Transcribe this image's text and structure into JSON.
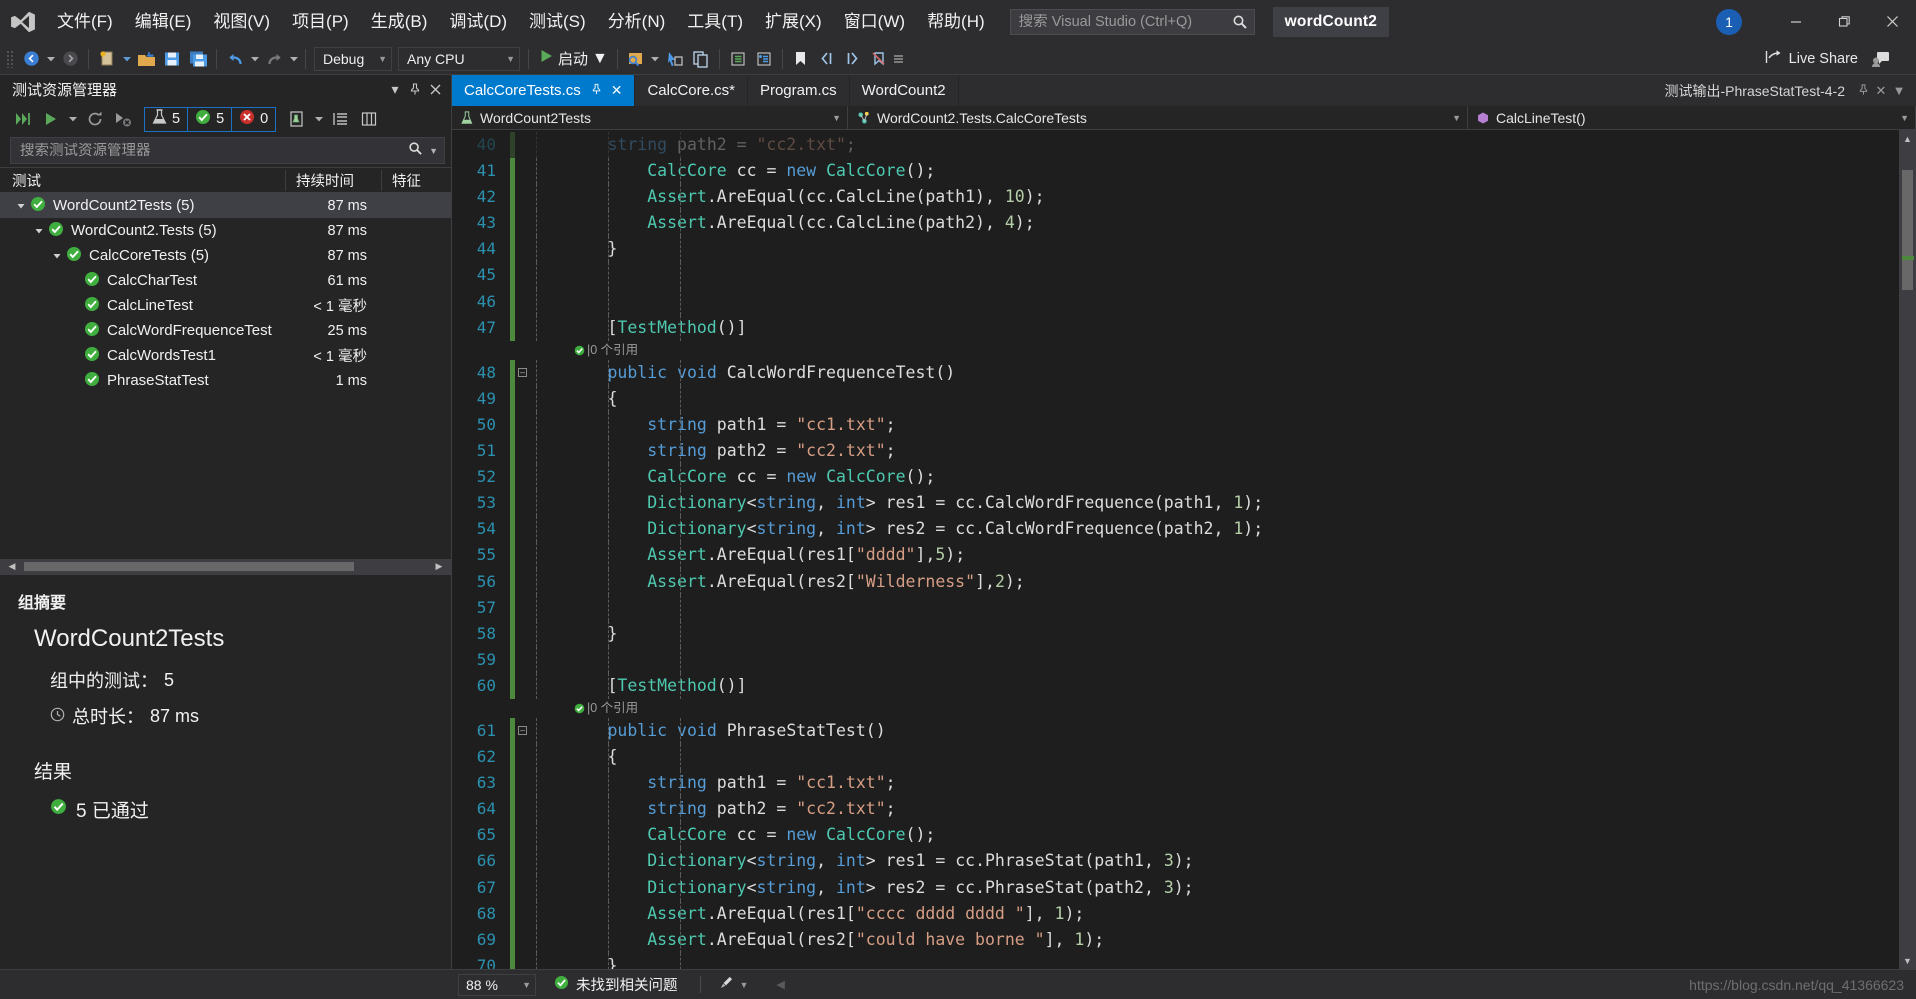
{
  "title_bar": {
    "logo_icon": "visual-studio-logo",
    "menus": [
      "文件(F)",
      "编辑(E)",
      "视图(V)",
      "项目(P)",
      "生成(B)",
      "调试(D)",
      "测试(S)",
      "分析(N)",
      "工具(T)",
      "扩展(X)",
      "窗口(W)",
      "帮助(H)"
    ],
    "search_placeholder": "搜索 Visual Studio (Ctrl+Q)",
    "search_value": "",
    "project_title": "wordCount2",
    "notification_count": "1",
    "minimize_label": "—",
    "restore_label": "❐",
    "close_label": "✕"
  },
  "toolbar": {
    "back_icon": "navigate-back-icon",
    "forward_icon": "navigate-forward-icon",
    "new_item_icon": "new-item-icon",
    "open_icon": "open-file-icon",
    "save_icon": "save-icon",
    "save_all_icon": "save-all-icon",
    "undo_icon": "undo-icon",
    "redo_icon": "redo-icon",
    "config_value": "Debug",
    "platform_value": "Any CPU",
    "start_label": "启动",
    "start_icon": "play-icon",
    "live_share_label": "Live Share",
    "live_share_icon": "live-share-icon",
    "feedback_icon": "feedback-icon"
  },
  "test_explorer": {
    "panel_title": "测试资源管理器",
    "pin_icon": "pin-icon",
    "close_icon": "close-icon",
    "run_all_icon": "run-all-tests-icon",
    "run_icon": "run-tests-icon",
    "repeat_icon": "repeat-last-run-icon",
    "cancel_icon": "cancel-run-icon",
    "counters": [
      {
        "icon": "flask-icon",
        "value": "5",
        "color": "#c9c9c9"
      },
      {
        "icon": "passed-icon",
        "value": "5",
        "color": "#4ec94e"
      },
      {
        "icon": "failed-icon",
        "value": "0",
        "color": "#e05c5c"
      }
    ],
    "playlist_icon": "playlist-icon",
    "group_icon": "group-by-icon",
    "columns_icon": "columns-icon",
    "search_placeholder": "搜索测试资源管理器",
    "search_value": "",
    "columns": [
      "测试",
      "持续时间",
      "特征"
    ],
    "rows": [
      {
        "label": "WordCount2Tests (5)",
        "duration": "87 ms",
        "depth": 0,
        "expander": "expanded",
        "status": "passed",
        "selected": true
      },
      {
        "label": "WordCount2.Tests (5)",
        "duration": "87 ms",
        "depth": 1,
        "expander": "expanded",
        "status": "passed",
        "selected": false
      },
      {
        "label": "CalcCoreTests (5)",
        "duration": "87 ms",
        "depth": 2,
        "expander": "expanded",
        "status": "passed",
        "selected": false
      },
      {
        "label": "CalcCharTest",
        "duration": "61 ms",
        "depth": 3,
        "expander": "none",
        "status": "passed",
        "selected": false
      },
      {
        "label": "CalcLineTest",
        "duration": "< 1 毫秒",
        "depth": 3,
        "expander": "none",
        "status": "passed",
        "selected": false
      },
      {
        "label": "CalcWordFrequenceTest",
        "duration": "25 ms",
        "depth": 3,
        "expander": "none",
        "status": "passed",
        "selected": false
      },
      {
        "label": "CalcWordsTest1",
        "duration": "< 1 毫秒",
        "depth": 3,
        "expander": "none",
        "status": "passed",
        "selected": false
      },
      {
        "label": "PhraseStatTest",
        "duration": "1 ms",
        "depth": 3,
        "expander": "none",
        "status": "passed",
        "selected": false
      }
    ],
    "summary": {
      "header": "组摘要",
      "name": "WordCount2Tests",
      "tests_in_group_label": "组中的测试：",
      "tests_in_group_value": "5",
      "total_duration_label": "总时长：",
      "total_duration_value": "87 ms",
      "clock_icon": "clock-icon",
      "results_header": "结果",
      "results_icon": "passed-icon",
      "results_text": "5  已通过"
    }
  },
  "editor": {
    "tabs": [
      {
        "label": "CalcCoreTests.cs",
        "active": true,
        "pin_icon": "pin-icon",
        "close_icon": "close-icon"
      },
      {
        "label": "CalcCore.cs*",
        "active": false
      },
      {
        "label": "Program.cs",
        "active": false
      },
      {
        "label": "WordCount2",
        "active": false
      }
    ],
    "output_tab": {
      "label": "测试输出-PhraseStatTest-4-2",
      "pin_icon": "pin-icon",
      "close_icon": "close-icon",
      "dropdown_icon": "chevron-down-icon"
    },
    "breadcrumb": [
      {
        "label": "WordCount2Tests",
        "icon": "project-icon"
      },
      {
        "label": "WordCount2.Tests.CalcCoreTests",
        "icon": "class-icon"
      },
      {
        "label": "CalcLineTest()",
        "icon": "method-icon"
      }
    ],
    "code_lines": [
      {
        "num": "40",
        "partial": true,
        "tokens": [
          {
            "t": "        ",
            "c": "pun"
          },
          {
            "t": "string",
            "c": "kw"
          },
          {
            "t": " path2 = ",
            "c": "id"
          },
          {
            "t": "\"cc2.txt\"",
            "c": "str"
          },
          {
            "t": ";",
            "c": "pun"
          }
        ],
        "change": "mod"
      },
      {
        "num": "41",
        "tokens": [
          {
            "t": "            ",
            "c": "pun"
          },
          {
            "t": "CalcCore",
            "c": "typ"
          },
          {
            "t": " cc = ",
            "c": "id"
          },
          {
            "t": "new",
            "c": "kw"
          },
          {
            "t": " ",
            "c": "id"
          },
          {
            "t": "CalcCore",
            "c": "typ"
          },
          {
            "t": "();",
            "c": "pun"
          }
        ],
        "change": "mod"
      },
      {
        "num": "42",
        "tokens": [
          {
            "t": "            ",
            "c": "pun"
          },
          {
            "t": "Assert",
            "c": "typ"
          },
          {
            "t": ".AreEqual(cc.CalcLine(path1), ",
            "c": "id"
          },
          {
            "t": "10",
            "c": "num2"
          },
          {
            "t": ");",
            "c": "pun"
          }
        ],
        "change": "mod"
      },
      {
        "num": "43",
        "tokens": [
          {
            "t": "            ",
            "c": "pun"
          },
          {
            "t": "Assert",
            "c": "typ"
          },
          {
            "t": ".AreEqual(cc.CalcLine(path2), ",
            "c": "id"
          },
          {
            "t": "4",
            "c": "num2"
          },
          {
            "t": ");",
            "c": "pun"
          }
        ],
        "change": "mod"
      },
      {
        "num": "44",
        "tokens": [
          {
            "t": "        }",
            "c": "pun"
          }
        ],
        "change": "mod"
      },
      {
        "num": "45",
        "tokens": [],
        "change": "mod"
      },
      {
        "num": "46",
        "tokens": [],
        "change": "mod"
      },
      {
        "num": "47",
        "tokens": [
          {
            "t": "        [",
            "c": "pun"
          },
          {
            "t": "TestMethod",
            "c": "typ"
          },
          {
            "t": "()]",
            "c": "pun"
          }
        ],
        "change": "mod",
        "ref": "0 个引用"
      },
      {
        "num": "48",
        "tokens": [
          {
            "t": "        ",
            "c": "pun"
          },
          {
            "t": "public",
            "c": "kw"
          },
          {
            "t": " ",
            "c": "id"
          },
          {
            "t": "void",
            "c": "kw"
          },
          {
            "t": " CalcWordFrequenceTest()",
            "c": "id"
          }
        ],
        "change": "mod",
        "fold": true
      },
      {
        "num": "49",
        "tokens": [
          {
            "t": "        {",
            "c": "pun"
          }
        ],
        "change": "mod"
      },
      {
        "num": "50",
        "tokens": [
          {
            "t": "            ",
            "c": "pun"
          },
          {
            "t": "string",
            "c": "kw"
          },
          {
            "t": " path1 = ",
            "c": "id"
          },
          {
            "t": "\"cc1.txt\"",
            "c": "str"
          },
          {
            "t": ";",
            "c": "pun"
          }
        ],
        "change": "mod"
      },
      {
        "num": "51",
        "tokens": [
          {
            "t": "            ",
            "c": "pun"
          },
          {
            "t": "string",
            "c": "kw"
          },
          {
            "t": " path2 = ",
            "c": "id"
          },
          {
            "t": "\"cc2.txt\"",
            "c": "str"
          },
          {
            "t": ";",
            "c": "pun"
          }
        ],
        "change": "mod"
      },
      {
        "num": "52",
        "tokens": [
          {
            "t": "            ",
            "c": "pun"
          },
          {
            "t": "CalcCore",
            "c": "typ"
          },
          {
            "t": " cc = ",
            "c": "id"
          },
          {
            "t": "new",
            "c": "kw"
          },
          {
            "t": " ",
            "c": "id"
          },
          {
            "t": "CalcCore",
            "c": "typ"
          },
          {
            "t": "();",
            "c": "pun"
          }
        ],
        "change": "mod"
      },
      {
        "num": "53",
        "tokens": [
          {
            "t": "            ",
            "c": "pun"
          },
          {
            "t": "Dictionary",
            "c": "typ"
          },
          {
            "t": "<",
            "c": "pun"
          },
          {
            "t": "string",
            "c": "kw"
          },
          {
            "t": ", ",
            "c": "pun"
          },
          {
            "t": "int",
            "c": "kw"
          },
          {
            "t": "> res1 = cc.CalcWordFrequence(path1, ",
            "c": "id"
          },
          {
            "t": "1",
            "c": "num2"
          },
          {
            "t": ");",
            "c": "pun"
          }
        ],
        "change": "mod"
      },
      {
        "num": "54",
        "tokens": [
          {
            "t": "            ",
            "c": "pun"
          },
          {
            "t": "Dictionary",
            "c": "typ"
          },
          {
            "t": "<",
            "c": "pun"
          },
          {
            "t": "string",
            "c": "kw"
          },
          {
            "t": ", ",
            "c": "pun"
          },
          {
            "t": "int",
            "c": "kw"
          },
          {
            "t": "> res2 = cc.CalcWordFrequence(path2, ",
            "c": "id"
          },
          {
            "t": "1",
            "c": "num2"
          },
          {
            "t": ");",
            "c": "pun"
          }
        ],
        "change": "mod"
      },
      {
        "num": "55",
        "tokens": [
          {
            "t": "            ",
            "c": "pun"
          },
          {
            "t": "Assert",
            "c": "typ"
          },
          {
            "t": ".AreEqual(res1[",
            "c": "id"
          },
          {
            "t": "\"dddd\"",
            "c": "str"
          },
          {
            "t": "],",
            "c": "pun"
          },
          {
            "t": "5",
            "c": "num2"
          },
          {
            "t": ");",
            "c": "pun"
          }
        ],
        "change": "mod"
      },
      {
        "num": "56",
        "tokens": [
          {
            "t": "            ",
            "c": "pun"
          },
          {
            "t": "Assert",
            "c": "typ"
          },
          {
            "t": ".AreEqual(res2[",
            "c": "id"
          },
          {
            "t": "\"Wilderness\"",
            "c": "str"
          },
          {
            "t": "],",
            "c": "pun"
          },
          {
            "t": "2",
            "c": "num2"
          },
          {
            "t": ");",
            "c": "pun"
          }
        ],
        "change": "mod"
      },
      {
        "num": "57",
        "tokens": [],
        "change": "mod"
      },
      {
        "num": "58",
        "tokens": [
          {
            "t": "        }",
            "c": "pun"
          }
        ],
        "change": "mod"
      },
      {
        "num": "59",
        "tokens": [],
        "change": "mod"
      },
      {
        "num": "60",
        "tokens": [
          {
            "t": "        [",
            "c": "pun"
          },
          {
            "t": "TestMethod",
            "c": "typ"
          },
          {
            "t": "()]",
            "c": "pun"
          }
        ],
        "change": "mod",
        "ref": "0 个引用"
      },
      {
        "num": "61",
        "tokens": [
          {
            "t": "        ",
            "c": "pun"
          },
          {
            "t": "public",
            "c": "kw"
          },
          {
            "t": " ",
            "c": "id"
          },
          {
            "t": "void",
            "c": "kw"
          },
          {
            "t": " PhraseStatTest()",
            "c": "id"
          }
        ],
        "change": "mod",
        "fold": true
      },
      {
        "num": "62",
        "tokens": [
          {
            "t": "        {",
            "c": "pun"
          }
        ],
        "change": "mod"
      },
      {
        "num": "63",
        "tokens": [
          {
            "t": "            ",
            "c": "pun"
          },
          {
            "t": "string",
            "c": "kw"
          },
          {
            "t": " path1 = ",
            "c": "id"
          },
          {
            "t": "\"cc1.txt\"",
            "c": "str"
          },
          {
            "t": ";",
            "c": "pun"
          }
        ],
        "change": "mod"
      },
      {
        "num": "64",
        "tokens": [
          {
            "t": "            ",
            "c": "pun"
          },
          {
            "t": "string",
            "c": "kw"
          },
          {
            "t": " path2 = ",
            "c": "id"
          },
          {
            "t": "\"cc2.txt\"",
            "c": "str"
          },
          {
            "t": ";",
            "c": "pun"
          }
        ],
        "change": "mod"
      },
      {
        "num": "65",
        "tokens": [
          {
            "t": "            ",
            "c": "pun"
          },
          {
            "t": "CalcCore",
            "c": "typ"
          },
          {
            "t": " cc = ",
            "c": "id"
          },
          {
            "t": "new",
            "c": "kw"
          },
          {
            "t": " ",
            "c": "id"
          },
          {
            "t": "CalcCore",
            "c": "typ"
          },
          {
            "t": "();",
            "c": "pun"
          }
        ],
        "change": "mod"
      },
      {
        "num": "66",
        "tokens": [
          {
            "t": "            ",
            "c": "pun"
          },
          {
            "t": "Dictionary",
            "c": "typ"
          },
          {
            "t": "<",
            "c": "pun"
          },
          {
            "t": "string",
            "c": "kw"
          },
          {
            "t": ", ",
            "c": "pun"
          },
          {
            "t": "int",
            "c": "kw"
          },
          {
            "t": "> res1 = cc.PhraseStat(path1, ",
            "c": "id"
          },
          {
            "t": "3",
            "c": "num2"
          },
          {
            "t": ");",
            "c": "pun"
          }
        ],
        "change": "mod"
      },
      {
        "num": "67",
        "tokens": [
          {
            "t": "            ",
            "c": "pun"
          },
          {
            "t": "Dictionary",
            "c": "typ"
          },
          {
            "t": "<",
            "c": "pun"
          },
          {
            "t": "string",
            "c": "kw"
          },
          {
            "t": ", ",
            "c": "pun"
          },
          {
            "t": "int",
            "c": "kw"
          },
          {
            "t": "> res2 = cc.PhraseStat(path2, ",
            "c": "id"
          },
          {
            "t": "3",
            "c": "num2"
          },
          {
            "t": ");",
            "c": "pun"
          }
        ],
        "change": "mod"
      },
      {
        "num": "68",
        "tokens": [
          {
            "t": "            ",
            "c": "pun"
          },
          {
            "t": "Assert",
            "c": "typ"
          },
          {
            "t": ".AreEqual(res1[",
            "c": "id"
          },
          {
            "t": "\"cccc dddd dddd \"",
            "c": "str"
          },
          {
            "t": "], ",
            "c": "pun"
          },
          {
            "t": "1",
            "c": "num2"
          },
          {
            "t": ");",
            "c": "pun"
          }
        ],
        "change": "mod"
      },
      {
        "num": "69",
        "tokens": [
          {
            "t": "            ",
            "c": "pun"
          },
          {
            "t": "Assert",
            "c": "typ"
          },
          {
            "t": ".AreEqual(res2[",
            "c": "id"
          },
          {
            "t": "\"could have borne \"",
            "c": "str"
          },
          {
            "t": "], ",
            "c": "pun"
          },
          {
            "t": "1",
            "c": "num2"
          },
          {
            "t": ");",
            "c": "pun"
          }
        ],
        "change": "mod"
      },
      {
        "num": "70",
        "tokens": [
          {
            "t": "        }",
            "c": "pun"
          }
        ],
        "change": "mod"
      }
    ]
  },
  "status_bar": {
    "zoom_value": "88 %",
    "problems_icon": "passed-icon",
    "problems_text": "未找到相关问题",
    "brush_icon": "brush-icon",
    "collapse_icon": "chevron-left-icon",
    "watermark": "https://blog.csdn.net/qq_41366623"
  },
  "colors": {
    "accent": "#007acc",
    "pass_green": "#3fae3f",
    "fail_red": "#c9302c",
    "chrome": "#2d2d30",
    "panel": "#252526",
    "editor_bg": "#1e1e1e"
  }
}
